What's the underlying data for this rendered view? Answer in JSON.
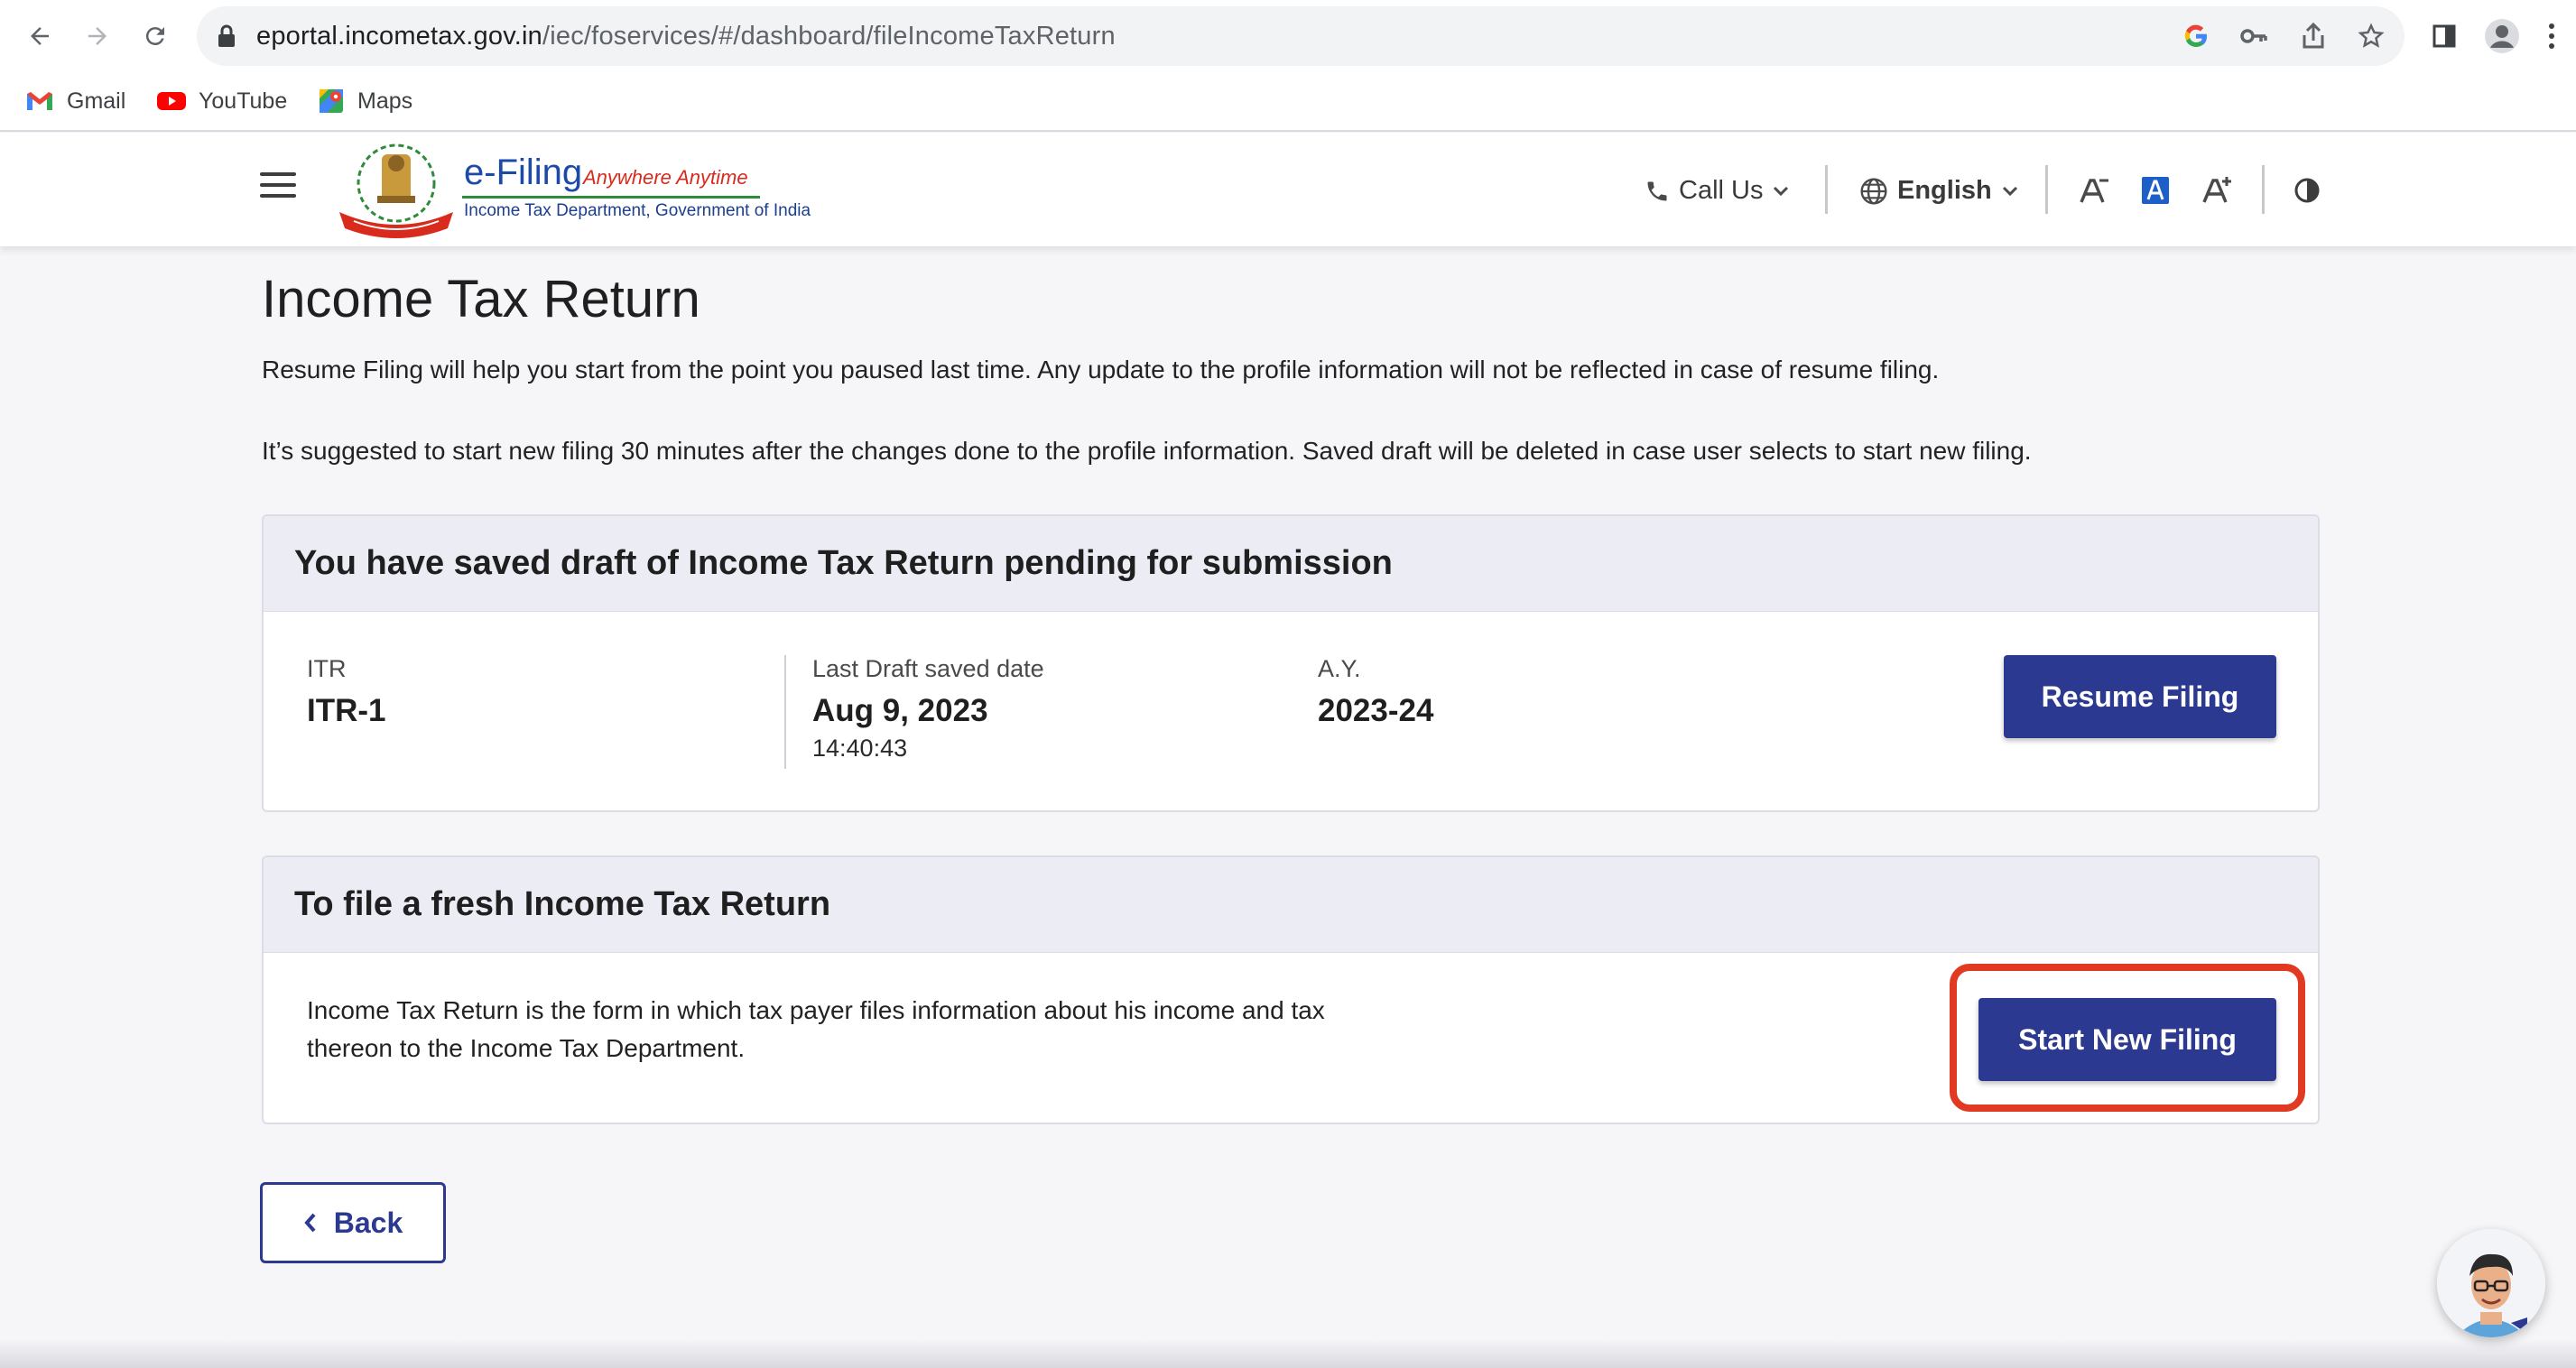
{
  "browser": {
    "url_host": "eportal.incometax.gov.in",
    "url_path": "/iec/foservices/#/dashboard/fileIncomeTaxReturn",
    "bookmarks": [
      {
        "label": "Gmail",
        "icon": "gmail-icon"
      },
      {
        "label": "YouTube",
        "icon": "youtube-icon"
      },
      {
        "label": "Maps",
        "icon": "maps-icon"
      }
    ]
  },
  "site": {
    "logo_title": "e-Filing",
    "logo_tagline": "Anywhere Anytime",
    "logo_subtitle": "Income Tax Department, Government of India",
    "call_us": "Call Us",
    "language": "English"
  },
  "page": {
    "title": "Income Tax Return",
    "intro_1": "Resume Filing will help you start from the point you paused last time. Any update to the profile information will not be reflected in case of resume filing.",
    "intro_2": "It’s suggested to start new filing 30 minutes after the changes done to the profile information. Saved draft will be deleted in case user selects to start new filing."
  },
  "draft_card": {
    "heading": "You have saved draft of Income Tax Return pending for submission",
    "itr_label": "ITR",
    "itr_value": "ITR-1",
    "date_label": "Last Draft saved date",
    "date_value": "Aug 9, 2023",
    "time_value": "14:40:43",
    "ay_label": "A.Y.",
    "ay_value": "2023-24",
    "resume_button": "Resume Filing"
  },
  "fresh_card": {
    "heading": "To file a fresh Income Tax Return",
    "description_line1": "Income Tax Return is the form in which tax payer files information about his income and tax",
    "description_line2": "thereon to the Income Tax Department.",
    "start_button": "Start New Filing"
  },
  "back_button": "Back",
  "colors": {
    "primary": "#2b3990",
    "highlight": "#e23a22",
    "card_header_bg": "#ececf5"
  }
}
